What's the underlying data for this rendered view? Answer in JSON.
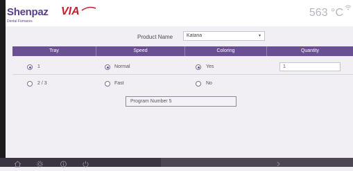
{
  "header": {
    "brand_main": "Shenpaz",
    "brand_suffix": "VIA",
    "tagline": "Dental Furnaces",
    "temperature": "563 °C"
  },
  "product": {
    "label": "Product Name",
    "selected": "Katana"
  },
  "table": {
    "columns": [
      "Tray",
      "Speed",
      "Coloring",
      "Quantity"
    ],
    "rows": [
      {
        "tray": "1",
        "speed": "Normal",
        "coloring": "Yes",
        "quantity": "1"
      },
      {
        "tray": "2 / 3",
        "speed": "Fast",
        "coloring": "No"
      }
    ]
  },
  "program": {
    "text": "Program Number  5"
  },
  "colors": {
    "accent": "#6a4f94",
    "background": "#f1eef4",
    "footer": "#3a3540"
  },
  "icons": [
    "wifi-icon",
    "home-icon",
    "settings-icon",
    "info-icon",
    "power-icon",
    "chevron-right-icon"
  ]
}
